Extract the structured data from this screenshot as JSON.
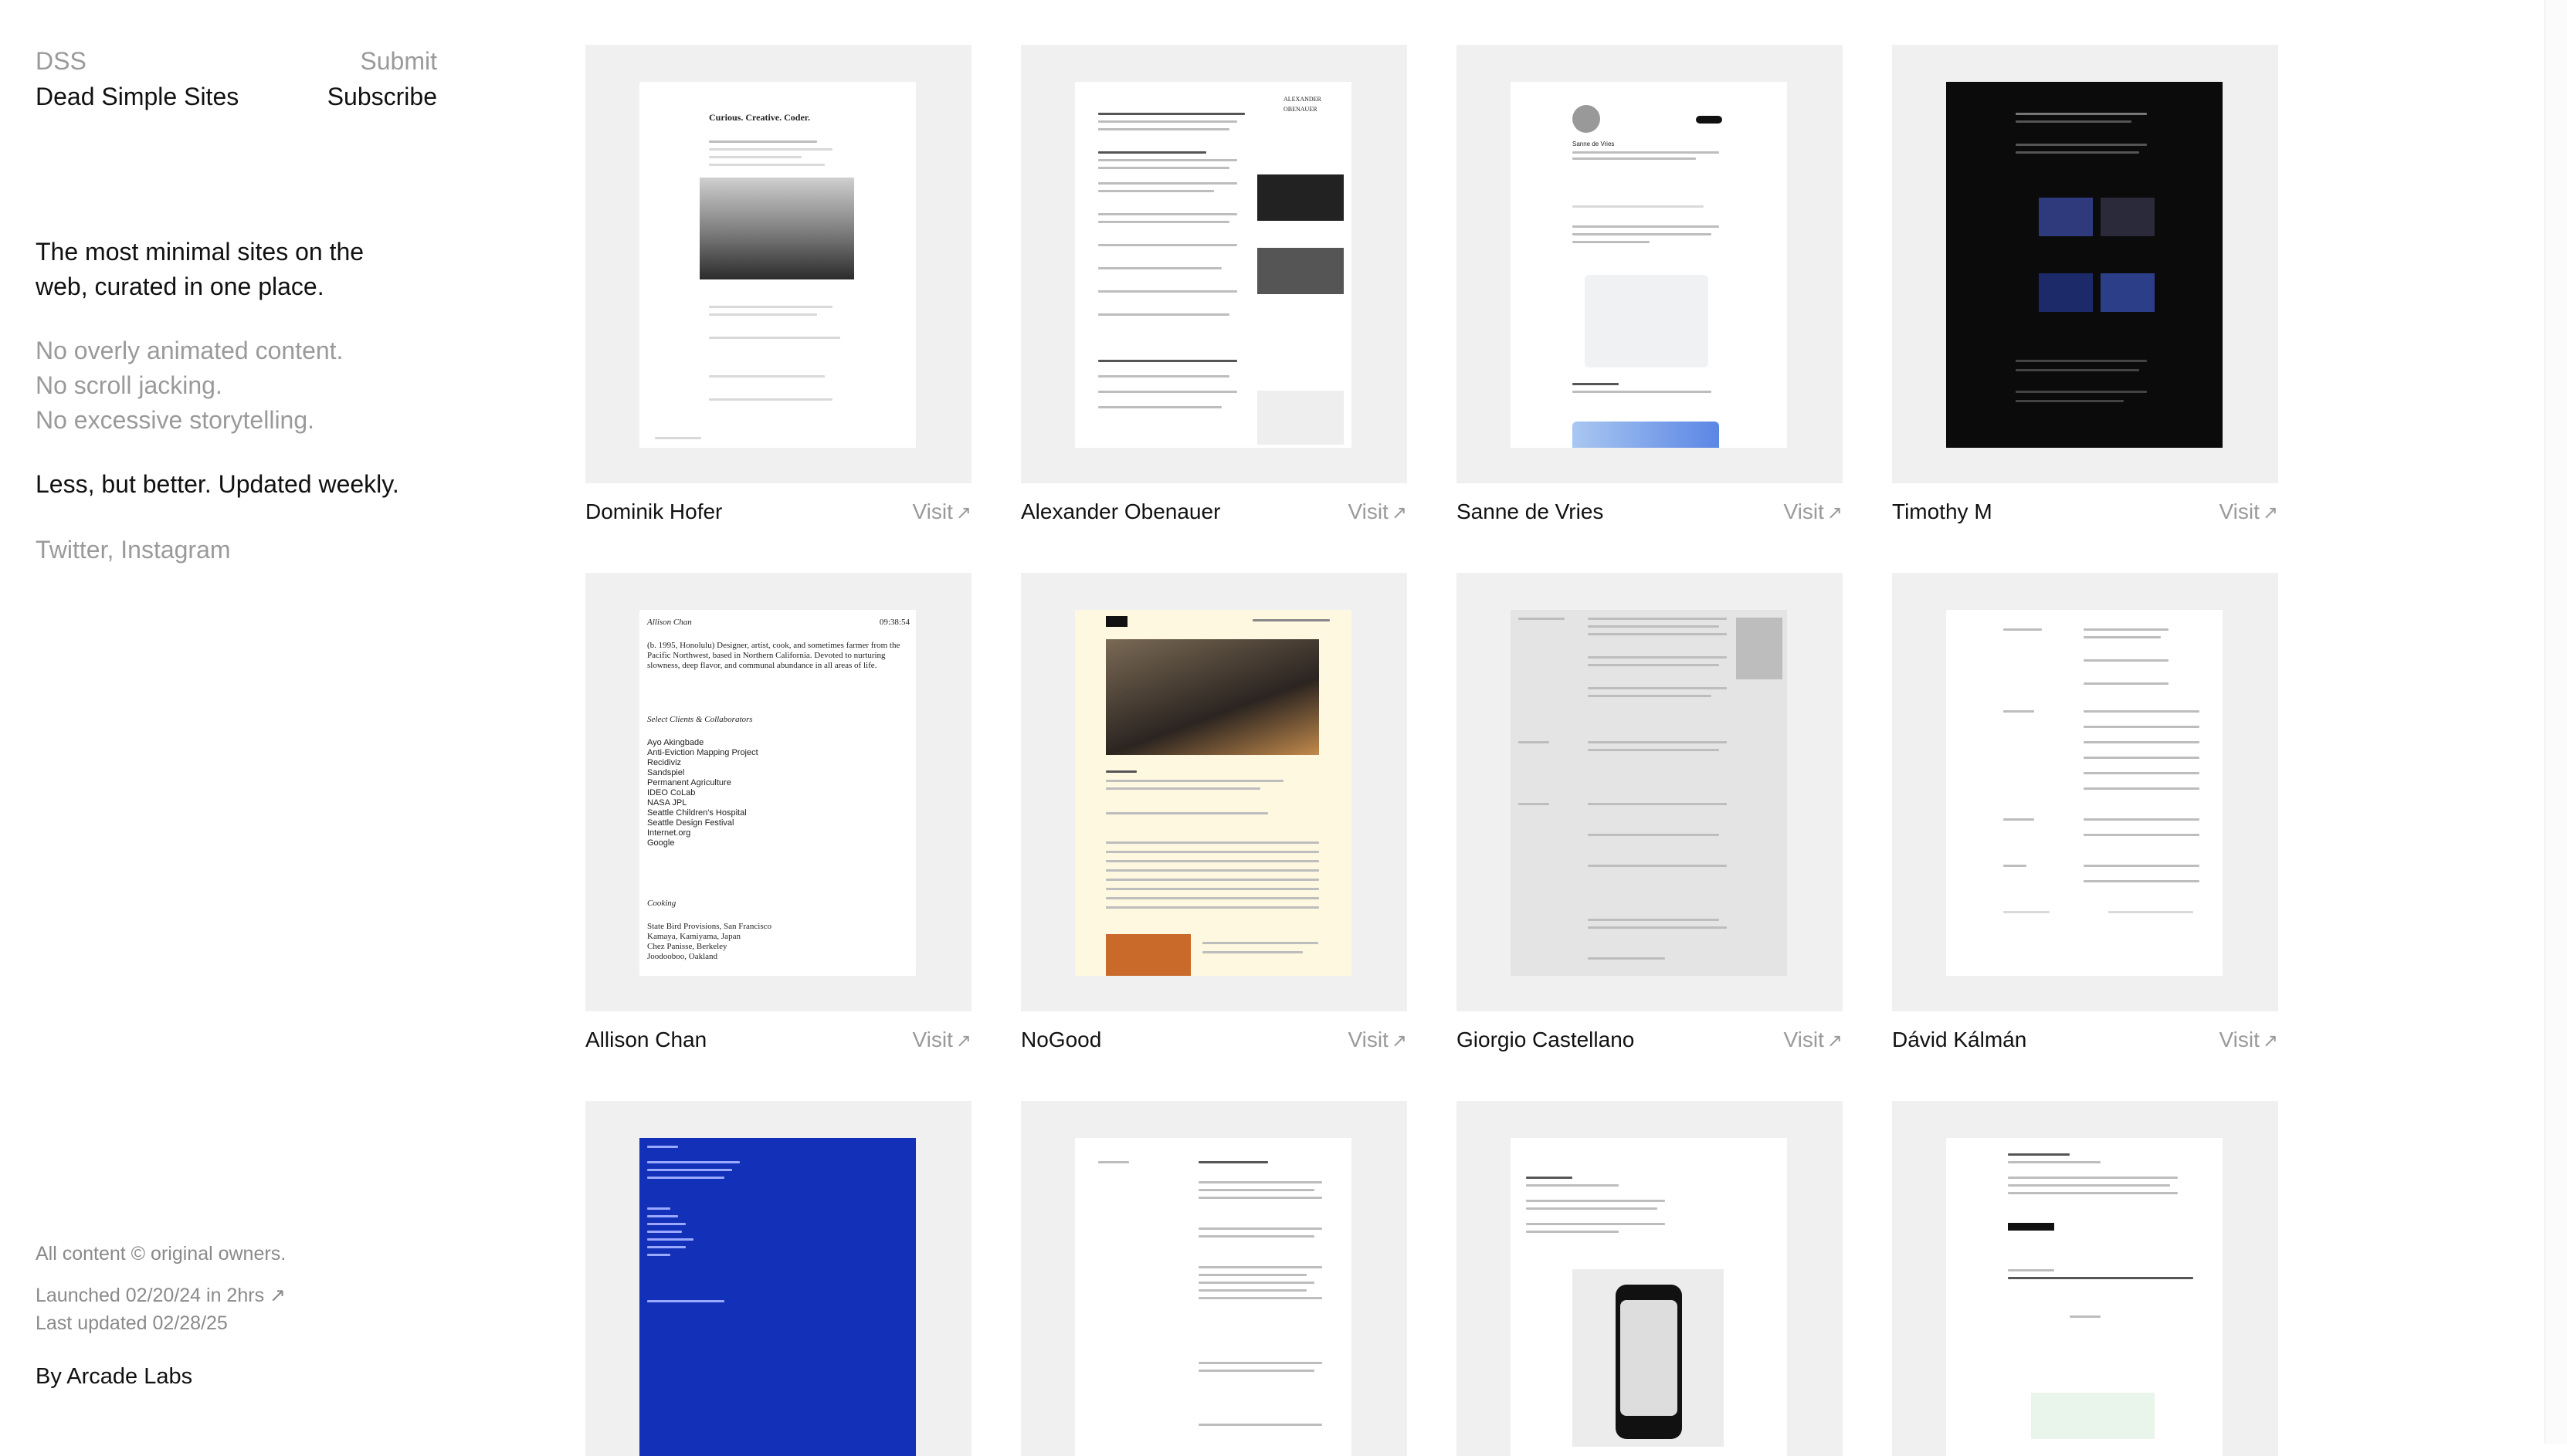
{
  "nav": {
    "site_abbr": "DSS",
    "site_name": "Dead Simple Sites",
    "submit_label": "Submit",
    "subscribe_label": "Subscribe"
  },
  "intro": {
    "headline": "The most minimal sites on the web, curated in one place.",
    "no_animation": "No overly animated content.",
    "no_scroll": "No scroll jacking.",
    "no_story": "No excessive storytelling.",
    "tagline": "Less, but better. Updated weekly.",
    "social": "Twitter, Instagram"
  },
  "footer": {
    "rights": "All content © original owners.",
    "launched": "Launched 02/20/24 in 2hrs",
    "launched_arrow": "↗",
    "updated": "Last updated 02/28/25",
    "by": "By Arcade Labs"
  },
  "visit_label": "Visit",
  "visit_arrow": "↗",
  "sites": [
    {
      "name": "Dominik Hofer",
      "preview_title": "Curious. Creative. Coder."
    },
    {
      "name": "Alexander Obenauer",
      "preview_title": "ALEXANDER OBENAUER"
    },
    {
      "name": "Sanne de Vries",
      "preview_title": "Sanne de Vries"
    },
    {
      "name": "Timothy M",
      "preview_title": ""
    },
    {
      "name": "Allison Chan",
      "preview_title": "Allison Chan",
      "preview_time": "09:38:54",
      "preview_bio": "(b. 1995, Honolulu) Designer, artist, cook, and sometimes farmer from the Pacific Northwest, based in Northern California. Devoted to nurturing slowness, deep flavor, and communal abundance in all areas of life.",
      "preview_clients_title": "Select Clients & Collaborators",
      "preview_clients": [
        "Ayo Akingbade",
        "Anti-Eviction Mapping Project",
        "Recidiviz",
        "Sandspiel",
        "Permanent Agriculture",
        "IDEO CoLab",
        "NASA JPL",
        "Seattle Children's Hospital",
        "Seattle Design Festival",
        "Internet.org",
        "Google"
      ],
      "preview_cooking_title": "Cooking",
      "preview_cooking": [
        "State Bird Provisions, San Francisco",
        "Kamaya, Kamiyama, Japan",
        "Chez Panisse, Berkeley",
        "Joodooboo, Oakland"
      ]
    },
    {
      "name": "NoGood",
      "preview_title": ""
    },
    {
      "name": "Giorgio Castellano",
      "preview_title": ""
    },
    {
      "name": "Dávid Kálmán",
      "preview_title": ""
    },
    {
      "name": "",
      "preview_title": ""
    },
    {
      "name": "",
      "preview_title": ""
    },
    {
      "name": "",
      "preview_title": ""
    },
    {
      "name": "",
      "preview_title": ""
    }
  ],
  "colors": {
    "thumb_bg": "#eff0ef",
    "muted_text": "#9a9a9a",
    "accent_blue": "#1230b8",
    "dark_preview": "#0b0b0b",
    "nogood_bg": "#fdf8df"
  }
}
